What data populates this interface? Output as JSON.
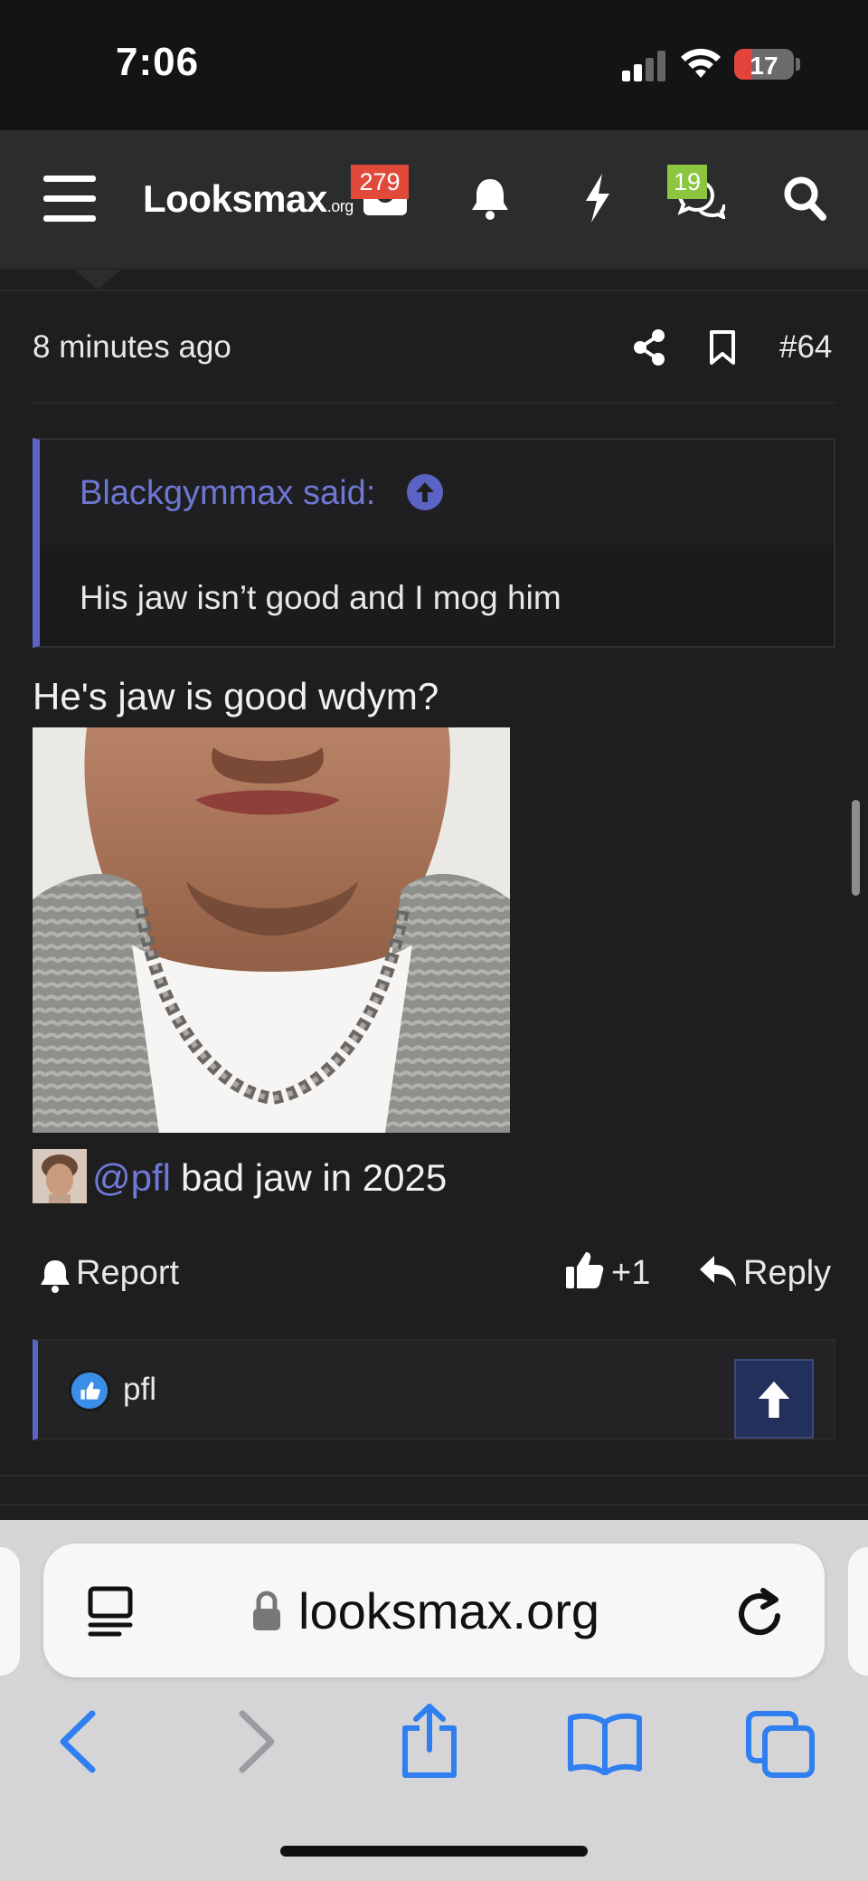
{
  "status_bar": {
    "time": "7:06",
    "battery": "17",
    "battery_level": 0.17
  },
  "navbar": {
    "logo_main": "Looksmax",
    "logo_suffix": ".org",
    "inbox_badge": "279",
    "chat_badge": "19"
  },
  "post": {
    "time": "8 minutes ago",
    "number": "#64",
    "quote": {
      "author": "Blackgymmax said:",
      "text": "His jaw isn’t good and I mog him"
    },
    "text": "He's jaw is good wdym?",
    "mention": "@pfl",
    "mention_rest": " bad jaw in 2025",
    "actions": {
      "report": "Report",
      "like_count": "+1",
      "reply": "Reply"
    },
    "reactions": {
      "user": "pfl"
    }
  },
  "browser": {
    "url": "looksmax.org"
  },
  "colors": {
    "accent": "#5b63c5",
    "link": "#7079d8",
    "ios_blue": "#2f7ff0"
  }
}
